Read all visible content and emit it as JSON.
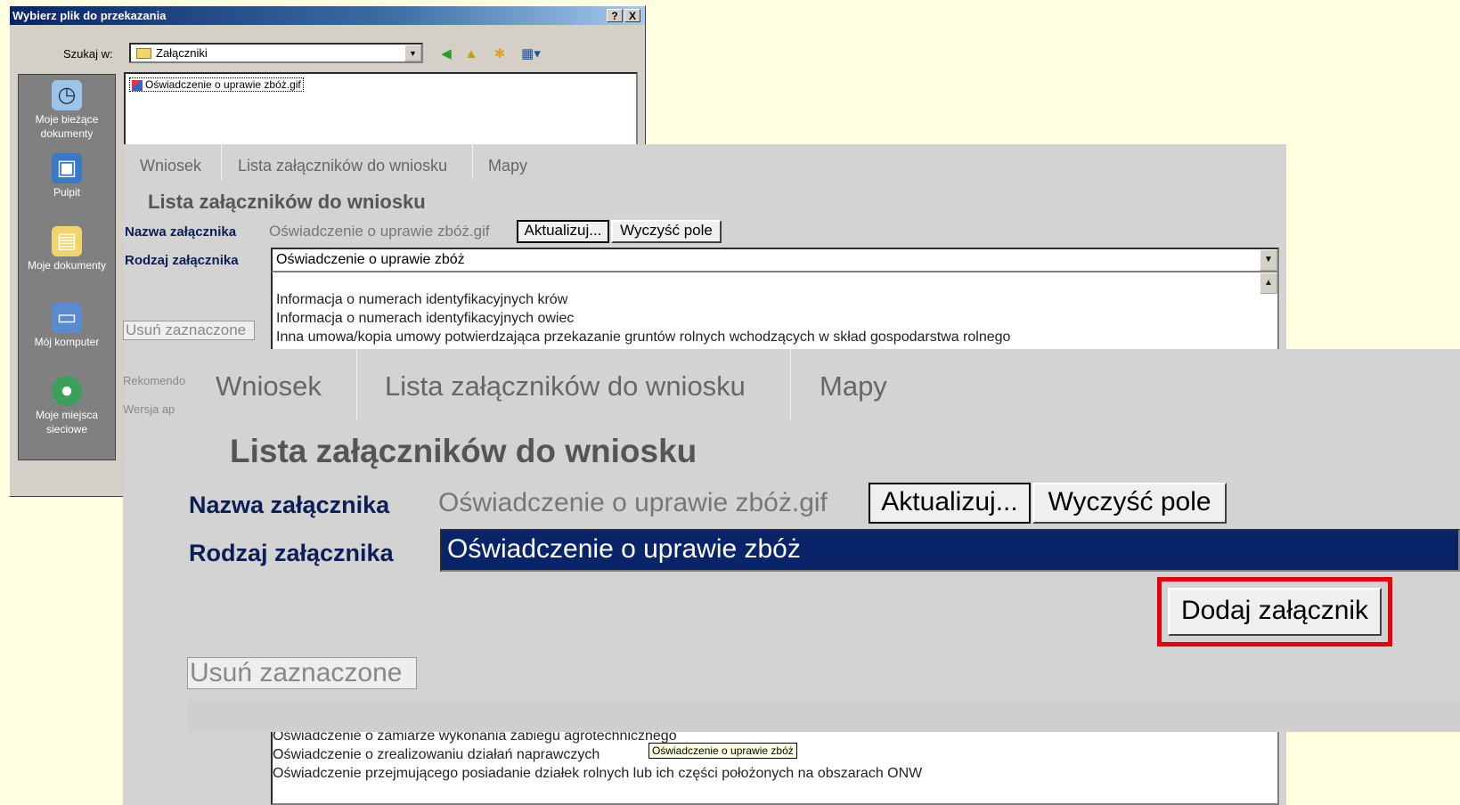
{
  "dialog": {
    "title": "Wybierz plik do przekazania",
    "help_button": "?",
    "close_button": "X",
    "lookin_label": "Szukaj w:",
    "lookin_value": "Załączniki",
    "places": [
      {
        "label": "Moje bieżące dokumenty",
        "icon": "recent-documents-icon"
      },
      {
        "label": "Pulpit",
        "icon": "desktop-icon"
      },
      {
        "label": "Moje dokumenty",
        "icon": "my-documents-icon"
      },
      {
        "label": "Mój komputer",
        "icon": "my-computer-icon"
      },
      {
        "label": "Moje miejsca sieciowe",
        "icon": "network-places-icon"
      }
    ],
    "file": "Oświadczenie o uprawie zbóż.gif"
  },
  "panel": {
    "tabs": [
      "Wniosek",
      "Lista załączników do wniosku",
      "Mapy"
    ],
    "title": "Lista załączników do wniosku",
    "name_label": "Nazwa załącznika",
    "name_value": "Oświadczenie o uprawie zbóż.gif",
    "update_button": "Aktualizuj...",
    "clear_button": "Wyczyść pole",
    "type_label": "Rodzaj załącznika",
    "type_value": "Oświadczenie o uprawie zbóż",
    "type_options": [
      "Informacja o numerach identyfikacyjnych krów",
      "Informacja o numerach identyfikacyjnych owiec",
      "Inna umowa/kopia umowy potwierdzająca przekazanie gruntów rolnych wchodzących w skład gospodarstwa rolnego"
    ],
    "remove_button": "Usuń zaznaczone",
    "footer_1": "Rekomendo",
    "footer_2": "Wersja ap"
  },
  "zoom": {
    "tabs": [
      "Wniosek",
      "Lista załączników do wniosku",
      "Mapy"
    ],
    "title": "Lista załączników do wniosku",
    "name_label": "Nazwa załącznika",
    "name_value": "Oświadczenie o uprawie zbóż.gif",
    "update_button": "Aktualizuj...",
    "clear_button": "Wyczyść pole",
    "type_label": "Rodzaj załącznika",
    "type_value": "Oświadczenie o uprawie zbóż",
    "add_button": "Dodaj załącznik",
    "remove_button": "Usuń zaznaczone",
    "highlight_color": "#e8000b"
  },
  "lower_list": [
    "Oświadczenie o zamiarze wykonania zabiegu agrotechnicznego",
    "Oświadczenie o zrealizowaniu działań naprawczych",
    "Oświadczenie przejmującego posiadanie działek rolnych lub ich części położonych na obszarach ONW"
  ],
  "tooltip": "Oświadczenie o uprawie zbóż"
}
